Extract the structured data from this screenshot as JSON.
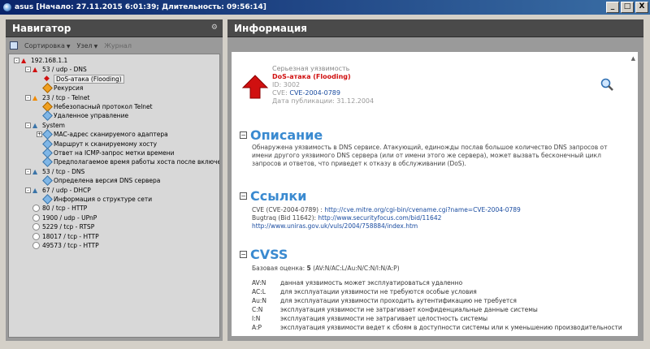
{
  "window": {
    "title": "asus [Начало: 27.11.2015 6:01:39; Длительность: 09:56:14]",
    "buttons": [
      "_",
      "□",
      "X"
    ]
  },
  "navigator": {
    "title": "Навигатор",
    "toolbar": {
      "sort": "Сортировка",
      "node": "Узел",
      "journal": "Журнал"
    },
    "tree": [
      {
        "label": "192.168.1.1",
        "icon": "red-arrow",
        "level": 0,
        "expander": "-"
      },
      {
        "label": "53 / udp - DNS",
        "icon": "red-arrow",
        "level": 1,
        "expander": "-"
      },
      {
        "label": "DoS-атака (Flooding)",
        "icon": "red-diamond",
        "level": 2,
        "expander": "",
        "selected": true
      },
      {
        "label": "Рекурсия",
        "icon": "orange-diamond",
        "level": 2,
        "expander": ""
      },
      {
        "label": "23 / tcp - Telnet",
        "icon": "orange-arrow",
        "level": 1,
        "expander": "-"
      },
      {
        "label": "Небезопасный протокол Telnet",
        "icon": "orange-diamond",
        "level": 2,
        "expander": ""
      },
      {
        "label": "Удаленное управление",
        "icon": "blue-diamond",
        "level": 2,
        "expander": ""
      },
      {
        "label": "System",
        "icon": "blue-arrow",
        "level": 1,
        "expander": "-"
      },
      {
        "label": "MAC-адрес сканируемого адаптера",
        "icon": "blue-diamond",
        "level": 2,
        "expander": "+"
      },
      {
        "label": "Маршрут к сканируемому хосту",
        "icon": "blue-diamond",
        "level": 2,
        "expander": ""
      },
      {
        "label": "Ответ на ICMP-запрос метки времени",
        "icon": "blue-diamond",
        "level": 2,
        "expander": ""
      },
      {
        "label": "Предполагаемое время работы хоста после включения",
        "icon": "blue-diamond",
        "level": 2,
        "expander": ""
      },
      {
        "label": "53 / tcp - DNS",
        "icon": "blue-arrow",
        "level": 1,
        "expander": "-"
      },
      {
        "label": "Определена версия DNS сервера",
        "icon": "blue-diamond",
        "level": 2,
        "expander": ""
      },
      {
        "label": "67 / udp - DHCP",
        "icon": "blue-arrow",
        "level": 1,
        "expander": "-"
      },
      {
        "label": "Информация о структуре сети",
        "icon": "blue-diamond",
        "level": 2,
        "expander": ""
      },
      {
        "label": "80 / tcp - HTTP",
        "icon": "dot",
        "level": 1,
        "expander": ""
      },
      {
        "label": "1900 / udp - UPnP",
        "icon": "dot",
        "level": 1,
        "expander": ""
      },
      {
        "label": "5229 / tcp - RTSP",
        "icon": "dot",
        "level": 1,
        "expander": ""
      },
      {
        "label": "18017 / tcp - HTTP",
        "icon": "dot",
        "level": 1,
        "expander": ""
      },
      {
        "label": "49573 / tcp - HTTP",
        "icon": "dot",
        "level": 1,
        "expander": ""
      }
    ]
  },
  "info": {
    "title": "Информация",
    "severity": "Серьезная уязвимость",
    "name": "DoS-атака (Flooding)",
    "id_line": "ID: 3002",
    "cve_prefix": "CVE: ",
    "cve": "CVE-2004-0789",
    "published": "Дата публикации: 31.12.2004",
    "description": {
      "heading": "Описание",
      "text": "Обнаружена уязвимость в DNS сервисе. Атакующий, единожды послав большое количество DNS запросов от имени другого уязвимого DNS сервера (или от имени этого же сервера), может вызвать бесконечный цикл запросов и ответов, что приведет к отказу в обслуживании (DoS)."
    },
    "links": {
      "heading": "Ссылки",
      "cve_label": "CVE (CVE-2004-0789) : ",
      "cve_url": "http://cve.mitre.org/cgi-bin/cvename.cgi?name=CVE-2004-0789",
      "bugtraq_label": "Bugtraq (Bid 11642): ",
      "bugtraq_url": "http://www.securityfocus.com/bid/11642",
      "uniras_url": "http://www.uniras.gov.uk/vuls/2004/758884/index.htm"
    },
    "cvss": {
      "heading": "CVSS",
      "base_label": "Базовая оценка: ",
      "base_score": "5",
      "vector": "(AV:N/AC:L/Au:N/C:N/I:N/A:P)",
      "rows": [
        {
          "code": "AV:N",
          "text": "данная уязвимость может эксплуатироваться удаленно"
        },
        {
          "code": "AC:L",
          "text": "для эксплуатации уязвимости не требуются особые условия"
        },
        {
          "code": "Au:N",
          "text": "для эксплуатации уязвимости проходить аутентификацию не требуется"
        },
        {
          "code": "C:N",
          "text": "эксплуатация уязвимости не затрагивает конфиденциальные данные системы"
        },
        {
          "code": "I:N",
          "text": "эксплуатация уязвимости не затрагивает целостность системы"
        },
        {
          "code": "A:P",
          "text": "эксплуатация уязвимости ведет к сбоям в доступности системы или к уменьшению производительности"
        }
      ]
    }
  }
}
